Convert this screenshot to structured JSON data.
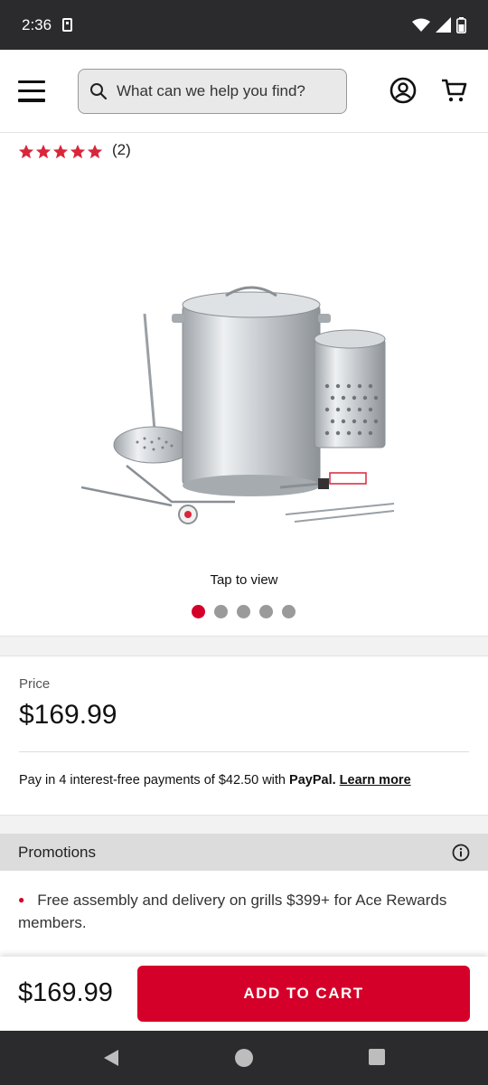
{
  "status_bar": {
    "time": "2:36"
  },
  "header": {
    "search_placeholder": "What can we help you find?",
    "icons": [
      "menu-icon",
      "search-icon",
      "account-icon",
      "cart-icon"
    ]
  },
  "product": {
    "rating": 5,
    "rating_count": "(2)",
    "tap_hint": "Tap to view",
    "image_count": 5,
    "active_image": 0
  },
  "price_section": {
    "label": "Price",
    "price": "$169.99",
    "paypal_prefix": "Pay in 4 interest-free payments of $42.50 with ",
    "paypal_brand": "PayPal.",
    "learn_more": "Learn more"
  },
  "promotions": {
    "title": "Promotions",
    "items": [
      "Free assembly and delivery on grills $399+ for Ace Rewards members."
    ]
  },
  "buy_bar": {
    "price": "$169.99",
    "button_label": "ADD TO CART"
  },
  "colors": {
    "accent": "#d40029",
    "star": "#d9263b",
    "system_bar": "#2b2b2e"
  }
}
